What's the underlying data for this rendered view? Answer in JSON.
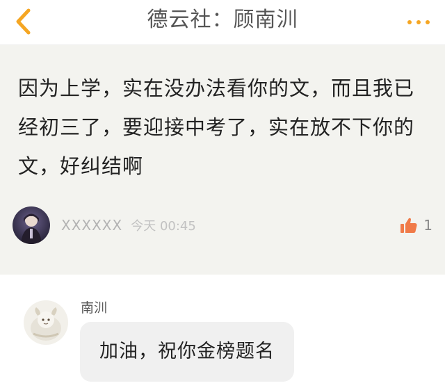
{
  "header": {
    "title": "德云社：顾南汌",
    "back_icon": "chevron-left-icon",
    "more_icon": "more-dots-icon",
    "accent_color": "#f5a623"
  },
  "post": {
    "text": "因为上学，实在没办法看你的文，而且我已经初三了，要迎接中考了，实在放不下你的文，好纠结啊",
    "author": "XXXXXX",
    "time": "今天 00:45",
    "like_count": "1",
    "like_color": "#f07a48"
  },
  "reply": {
    "author": "南汌",
    "text": "加油，祝你金榜题名"
  }
}
